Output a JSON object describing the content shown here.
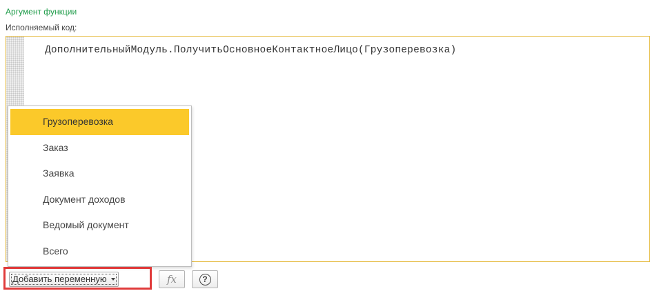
{
  "header": {
    "section_title": "Аргумент функции",
    "code_label": "Исполняемый код:"
  },
  "editor": {
    "code": "ДополнительныйМодуль.ПолучитьОсновноеКонтактноеЛицо(Грузоперевозка)"
  },
  "dropdown": {
    "items": [
      {
        "label": "Грузоперевозка",
        "selected": true
      },
      {
        "label": "Заказ",
        "selected": false
      },
      {
        "label": "Заявка",
        "selected": false
      },
      {
        "label": "Документ доходов",
        "selected": false
      },
      {
        "label": "Ведомый документ",
        "selected": false
      },
      {
        "label": "Всего",
        "selected": false
      }
    ]
  },
  "toolbar": {
    "add_variable_label": "Добавить переменную",
    "fx_label": "fx",
    "help_label": "?"
  },
  "colors": {
    "section_title": "#1f9c4a",
    "selection": "#fbc92a",
    "editor_border": "#e5b93a",
    "highlight": "#e03a3a"
  },
  "icons": [
    "chevron-down-icon",
    "function-icon",
    "help-icon"
  ]
}
